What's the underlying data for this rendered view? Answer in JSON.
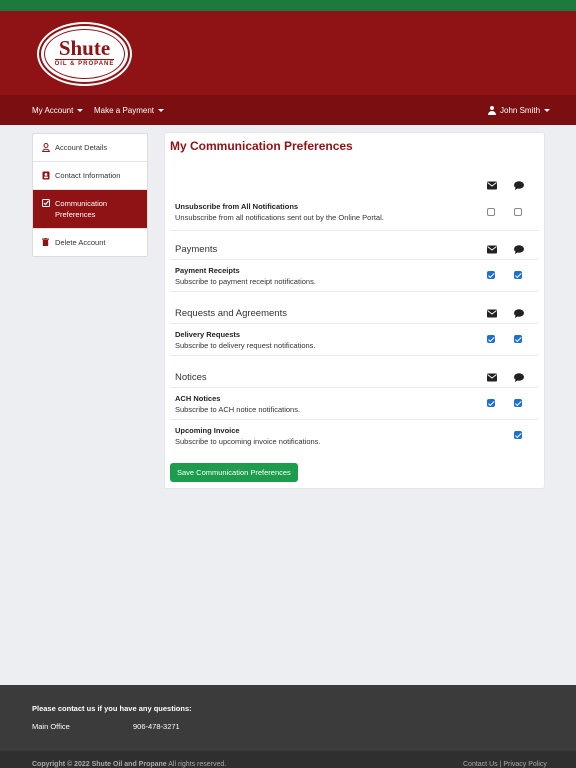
{
  "brand": {
    "logo_main": "Shute",
    "logo_sub": "OIL & PROPANE"
  },
  "colors": {
    "brand_red": "#8f1214",
    "nav_red": "#7a0e10",
    "top_green": "#1e7a3c",
    "save_green": "#1e9c4e",
    "checkbox_blue": "#1f6fd1"
  },
  "nav": {
    "my_account": "My Account",
    "make_payment": "Make a Payment",
    "user_name": "John Smith"
  },
  "sidebar": {
    "items": [
      {
        "label": "Account Details",
        "icon": "user-icon"
      },
      {
        "label": "Contact Information",
        "icon": "contact-card-icon"
      },
      {
        "label": "Communication Preferences",
        "icon": "checked-box-icon",
        "active": true
      },
      {
        "label": "Delete Account",
        "icon": "trash-icon"
      }
    ]
  },
  "prefs": {
    "title": "My Communication Preferences",
    "column_icons": [
      "envelope-icon",
      "chat-bubble-icon"
    ],
    "unsubscribe": {
      "title": "Unsubscribe from All Notifications",
      "desc": "Unsubscribe from all notifications sent out by the Online Portal.",
      "email": false,
      "sms": false
    },
    "sections": [
      {
        "name": "Payments",
        "rows": [
          {
            "title": "Payment Receipts",
            "desc": "Subscribe to payment receipt notifications.",
            "email": true,
            "sms": true
          }
        ]
      },
      {
        "name": "Requests and Agreements",
        "rows": [
          {
            "title": "Delivery Requests",
            "desc": "Subscribe to delivery request notifications.",
            "email": true,
            "sms": true
          }
        ]
      },
      {
        "name": "Notices",
        "rows": [
          {
            "title": "ACH Notices",
            "desc": "Subscribe to ACH notice notifications.",
            "email": true,
            "sms": true
          },
          {
            "title": "Upcoming Invoice",
            "desc": "Subscribe to upcoming invoice notifications.",
            "email": null,
            "sms": true
          }
        ]
      }
    ],
    "save_label": "Save Communication Preferences"
  },
  "footer": {
    "contact_heading": "Please contact us if you have any questions:",
    "office_label": "Main Office",
    "office_phone": "906-478-3271",
    "copyright": "Copyright © 2022 Shute Oil and Propane",
    "rights": "All rights reserved.",
    "contact_link": "Contact Us",
    "separator": "|",
    "privacy_link": "Privacy Policy"
  }
}
